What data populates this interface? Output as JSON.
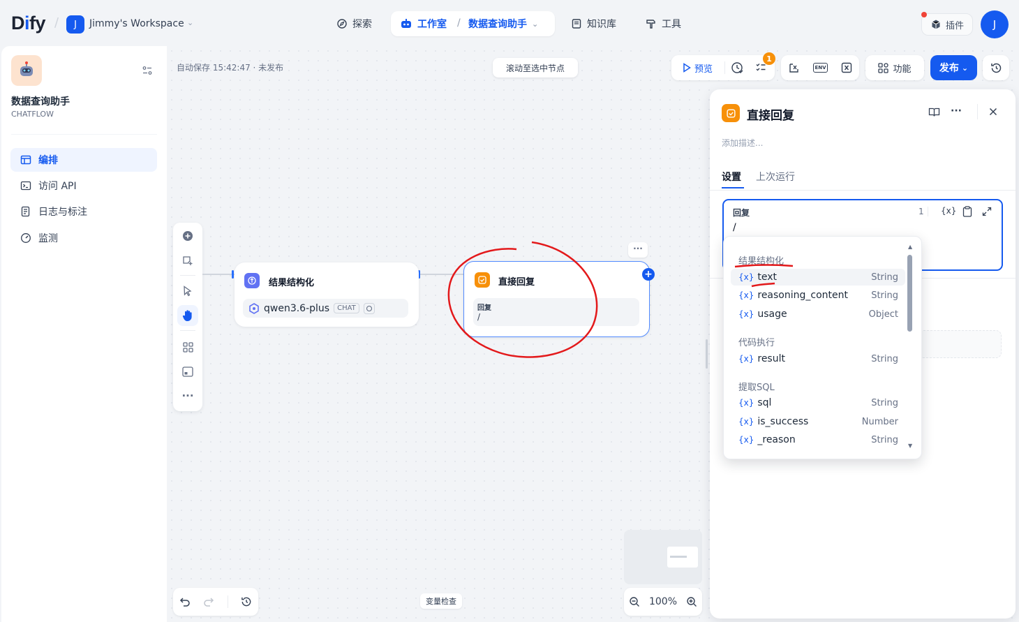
{
  "header": {
    "logo_text": "Dify",
    "workspace_initial": "J",
    "workspace_name": "Jimmy's Workspace",
    "nav_explore": "探索",
    "nav_studio": "工作室",
    "nav_app": "数据查询助手",
    "nav_knowledge": "知识库",
    "nav_tools": "工具",
    "plugins": "插件",
    "user_initial": "J"
  },
  "sidebar": {
    "app_name": "数据查询助手",
    "app_type": "CHATFLOW",
    "items": [
      {
        "label": "编排"
      },
      {
        "label": "访问 API"
      },
      {
        "label": "日志与标注"
      },
      {
        "label": "监测"
      }
    ]
  },
  "canvas": {
    "autosave": "自动保存 15:42:47 · 未发布",
    "scroll_to_selected": "滚动至选中节点",
    "preview": "预览",
    "checklist_count": "1",
    "features": "功能",
    "publish": "发布",
    "env_label": "ENV",
    "var_inspect": "变量检查",
    "zoom": "100%"
  },
  "nodes": {
    "llm": {
      "title": "结果结构化",
      "model": "qwen3.6-plus",
      "model_tag": "CHAT"
    },
    "answer": {
      "title": "直接回复",
      "field_label": "回复",
      "field_value": "/"
    }
  },
  "panel": {
    "title": "直接回复",
    "desc_placeholder": "添加描述...",
    "tab_settings": "设置",
    "tab_last_run": "上次运行",
    "field_label": "回复",
    "char_count": "1",
    "var_button": "{x}",
    "editor_value": "/"
  },
  "dropdown": {
    "var_prefix": "{x}",
    "groups": [
      {
        "name": "结果结构化",
        "vars": [
          {
            "name": "text",
            "type": "String"
          },
          {
            "name": "reasoning_content",
            "type": "String"
          },
          {
            "name": "usage",
            "type": "Object"
          }
        ]
      },
      {
        "name": "代码执行",
        "vars": [
          {
            "name": "result",
            "type": "String"
          }
        ]
      },
      {
        "name": "提取SQL",
        "vars": [
          {
            "name": "sql",
            "type": "String"
          },
          {
            "name": "is_success",
            "type": "Number"
          },
          {
            "name": "_reason",
            "type": "String"
          }
        ]
      }
    ]
  },
  "colors": {
    "accent": "#155aef",
    "annotation": "#e3191b",
    "answer_node": "#f79009",
    "llm_node": "#6172f3"
  }
}
